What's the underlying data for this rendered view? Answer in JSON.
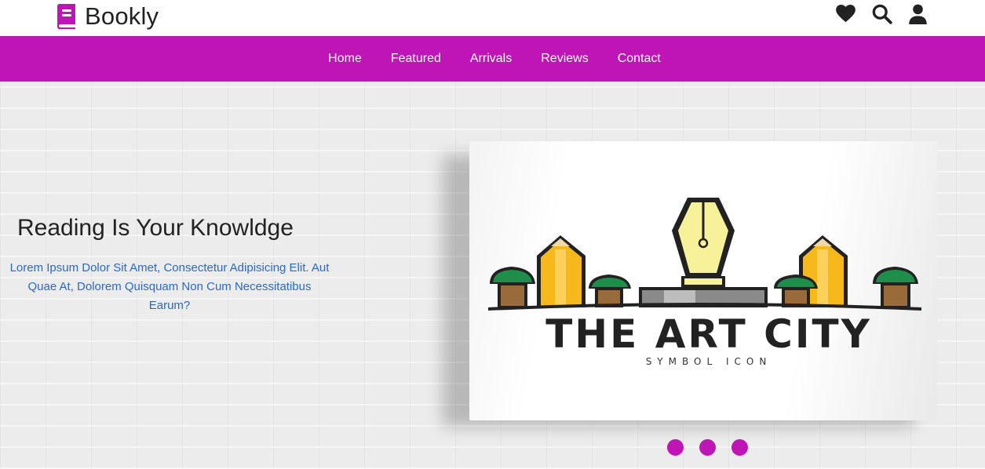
{
  "brand": {
    "name": "Bookly",
    "icon": "book-icon",
    "color": "#bf14b6"
  },
  "header": {
    "icons": [
      "heart-icon",
      "search-icon",
      "user-icon"
    ]
  },
  "nav": {
    "items": [
      {
        "label": "Home"
      },
      {
        "label": "Featured"
      },
      {
        "label": "Arrivals"
      },
      {
        "label": "Reviews"
      },
      {
        "label": "Contact"
      }
    ]
  },
  "hero": {
    "title": "Reading Is Your Knowldge",
    "text": "Lorem Ipsum Dolor Sit Amet, Consectetur Adipisicing Elit. Aut Quae At, Dolorem Quisquam Non Cum Necessitatibus Earum?",
    "book": {
      "title": "THE ART CITY",
      "subtitle": "SYMBOL ICON"
    },
    "slider_dots": 3
  },
  "colors": {
    "accent": "#bf14b6",
    "link_text": "#2b68c9"
  }
}
